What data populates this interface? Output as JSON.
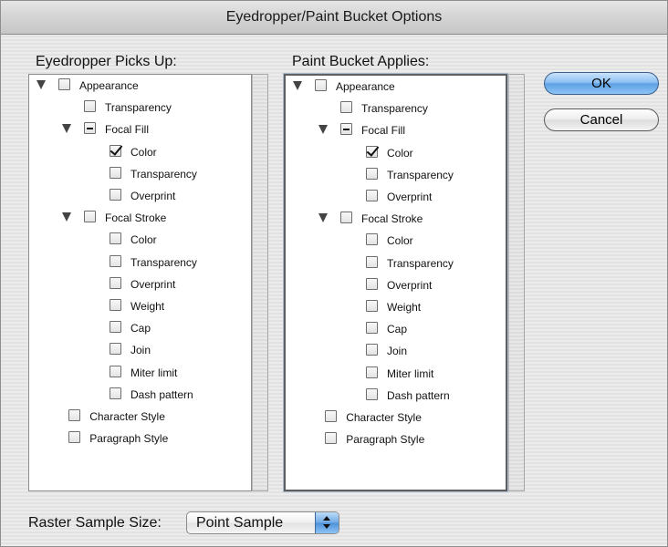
{
  "window": {
    "title": "Eyedropper/Paint Bucket Options"
  },
  "eyedropper": {
    "heading": "Eyedropper Picks Up:",
    "items": [
      {
        "label": "Appearance",
        "level": 0,
        "state": "unchecked",
        "expanded": true
      },
      {
        "label": "Transparency",
        "level": 1,
        "state": "unchecked"
      },
      {
        "label": "Focal Fill",
        "level": 1,
        "state": "mixed",
        "expanded": true
      },
      {
        "label": "Color",
        "level": 2,
        "state": "checked"
      },
      {
        "label": "Transparency",
        "level": 2,
        "state": "unchecked"
      },
      {
        "label": "Overprint",
        "level": 2,
        "state": "unchecked"
      },
      {
        "label": "Focal Stroke",
        "level": 1,
        "state": "unchecked",
        "expanded": true
      },
      {
        "label": "Color",
        "level": 2,
        "state": "unchecked"
      },
      {
        "label": "Transparency",
        "level": 2,
        "state": "unchecked"
      },
      {
        "label": "Overprint",
        "level": 2,
        "state": "unchecked"
      },
      {
        "label": "Weight",
        "level": 2,
        "state": "unchecked"
      },
      {
        "label": "Cap",
        "level": 2,
        "state": "unchecked"
      },
      {
        "label": "Join",
        "level": 2,
        "state": "unchecked"
      },
      {
        "label": "Miter limit",
        "level": 2,
        "state": "unchecked"
      },
      {
        "label": "Dash pattern",
        "level": 2,
        "state": "unchecked"
      },
      {
        "label": "Character Style",
        "level": 0.4,
        "state": "unchecked"
      },
      {
        "label": "Paragraph Style",
        "level": 0.4,
        "state": "unchecked"
      }
    ]
  },
  "paintbucket": {
    "heading": "Paint Bucket Applies:",
    "items": [
      {
        "label": "Appearance",
        "level": 0,
        "state": "unchecked",
        "expanded": true
      },
      {
        "label": "Transparency",
        "level": 1,
        "state": "unchecked"
      },
      {
        "label": "Focal Fill",
        "level": 1,
        "state": "mixed",
        "expanded": true
      },
      {
        "label": "Color",
        "level": 2,
        "state": "checked"
      },
      {
        "label": "Transparency",
        "level": 2,
        "state": "unchecked"
      },
      {
        "label": "Overprint",
        "level": 2,
        "state": "unchecked"
      },
      {
        "label": "Focal Stroke",
        "level": 1,
        "state": "unchecked",
        "expanded": true
      },
      {
        "label": "Color",
        "level": 2,
        "state": "unchecked"
      },
      {
        "label": "Transparency",
        "level": 2,
        "state": "unchecked"
      },
      {
        "label": "Overprint",
        "level": 2,
        "state": "unchecked"
      },
      {
        "label": "Weight",
        "level": 2,
        "state": "unchecked"
      },
      {
        "label": "Cap",
        "level": 2,
        "state": "unchecked"
      },
      {
        "label": "Join",
        "level": 2,
        "state": "unchecked"
      },
      {
        "label": "Miter limit",
        "level": 2,
        "state": "unchecked"
      },
      {
        "label": "Dash pattern",
        "level": 2,
        "state": "unchecked"
      },
      {
        "label": "Character Style",
        "level": 0.4,
        "state": "unchecked"
      },
      {
        "label": "Paragraph Style",
        "level": 0.4,
        "state": "unchecked"
      }
    ]
  },
  "buttons": {
    "ok": "OK",
    "cancel": "Cancel"
  },
  "raster": {
    "label": "Raster Sample Size:",
    "value": "Point Sample"
  },
  "colors": {
    "default_button": "#6fa9e4",
    "focus_ring": "#5f5f5f"
  }
}
